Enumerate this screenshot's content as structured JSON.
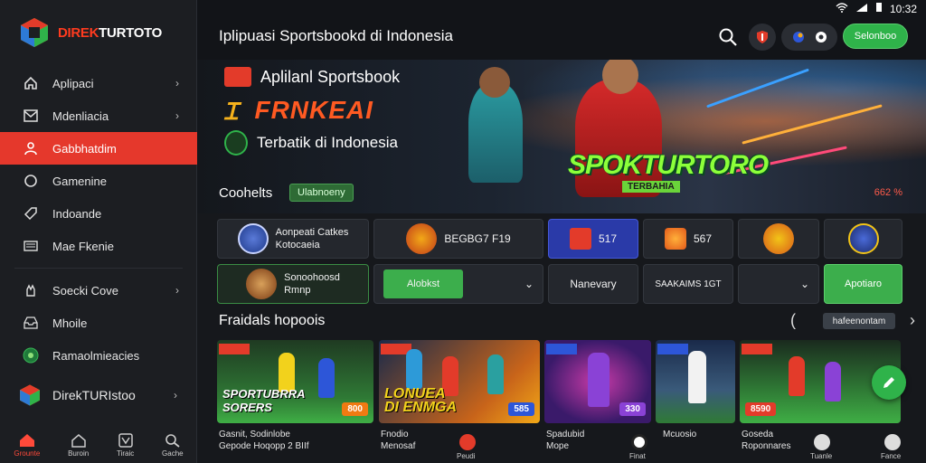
{
  "status": {
    "time": "10:32"
  },
  "brand": {
    "name_part1": "DIREK",
    "name_part2": "TURTOTO"
  },
  "sidebar": {
    "items": [
      {
        "label": "Aplipaci",
        "icon": "home-icon",
        "chevron": true
      },
      {
        "label": "Mdenliacia",
        "icon": "mail-icon",
        "chevron": true
      },
      {
        "label": "Gabbhatdim",
        "icon": "user-icon",
        "chevron": false,
        "active": true
      },
      {
        "label": "Gamenine",
        "icon": "circle-icon",
        "chevron": false
      },
      {
        "label": "Indoande",
        "icon": "tag-icon",
        "chevron": false
      },
      {
        "label": "Mae Fkenie",
        "icon": "keyboard-icon",
        "chevron": false
      },
      {
        "label": "Soecki Cove",
        "icon": "hand-icon",
        "chevron": true
      },
      {
        "label": "Mhoile",
        "icon": "inbox-icon",
        "chevron": false
      },
      {
        "label": "Ramaolmieacies",
        "icon": "globe-icon",
        "chevron": false
      }
    ],
    "brand2": "DirekTURIstoo"
  },
  "bottom_nav": [
    {
      "label": "Grounte",
      "active": true
    },
    {
      "label": "Buroin"
    },
    {
      "label": "Tiraic"
    },
    {
      "label": "Gache"
    }
  ],
  "topbar": {
    "title": "Iplipuasi Sportsbookd di Indonesia",
    "login_label": "Selonboo"
  },
  "hero": {
    "line1": "Aplilanl Sportsbook",
    "line2": "FRNKEAI",
    "line3": "Terbatik di Indonesia",
    "logo": "SPOKTURTORO",
    "logo_sub": "TERBAHIA"
  },
  "coef": {
    "title": "Coohelts",
    "tag": "Ulabnoeny",
    "right": "662 %",
    "row1": [
      {
        "line1": "Aonpeati Catkes",
        "line2": "Kotocaeia"
      },
      {
        "text": "BEGBG7 F19"
      },
      {
        "text": "517"
      },
      {
        "text": "567"
      }
    ],
    "row2": [
      {
        "line1": "Sonoohoosd",
        "line2": "Rmnp"
      },
      {
        "text": "Alobkst"
      },
      {
        "text": "Nanevary"
      },
      {
        "text": "SAAKAIMS 1GT"
      },
      {
        "text": "Apotiaro"
      }
    ]
  },
  "featured": {
    "title": "Fraidals hopoois",
    "more": "hafeenontam",
    "thumbs": [
      {
        "big": "SPORTUBRRA\nSORERS",
        "price": "800"
      },
      {
        "big": "LONUEA\nDI ENMGA",
        "price": "585"
      },
      {
        "big": "",
        "price": "330"
      },
      {
        "big": "",
        "price": ""
      },
      {
        "big": "",
        "price": "8590"
      }
    ],
    "captions": [
      "Gasnit, Sodinlobe\nGepode Hoqopp 2 BIIf",
      "Fnodio\nMenosaf",
      "Spadubid\nMope",
      "Mcuosio",
      "Goseda\nRoponnares"
    ],
    "mini_labels": [
      "Peudi",
      "Finat",
      "Tuanle",
      "Fance"
    ]
  }
}
